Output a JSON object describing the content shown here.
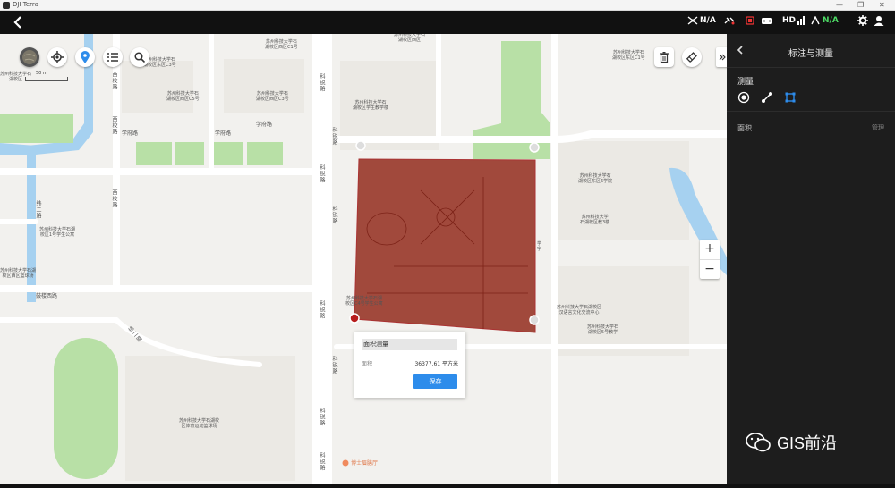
{
  "window": {
    "app_title": "DJI Terra",
    "controls": [
      "—",
      "❐",
      "✕"
    ]
  },
  "topbar": {
    "back_icon": "chevron-left-icon",
    "status": {
      "rc_signal": "N/A",
      "hd_label": "HD",
      "video_signal": "N/A",
      "video_signal_color": "#4cd964"
    }
  },
  "map": {
    "scale_label": "50 m",
    "pois": [
      "苏州科技大学石\n湖校区西区C1号",
      "苏州科技大学石\n湖校区西区",
      "苏州科技大学石\n湖校区东区C1号",
      "苏州科技大学石\n湖校区西区C5号",
      "苏州科技大学石\n湖校区西区C3号",
      "苏州科技大学石\n湖校区东区C3号",
      "苏州科技大学石\n湖校区",
      "苏州科技大学石\n湖校区学生教学楼",
      "苏州科技大学石\n湖校区东区6学院",
      "苏州科技大学\n石湖校区教3楼",
      "苏州科技大学石湖\n校区1号学生公寓",
      "苏州科技大学石湖校区\n汉语言文化交流中心",
      "苏州科技大学石\n湖校区5号教学",
      "苏州科技大学石湖校\n区体育运动篮球场",
      "苏州科技大学石湖\n校区西区篮球场",
      "苏州科技大学石湖\n校区C4号学生公寓",
      "学\n字"
    ],
    "roads": [
      "学府路",
      "学府路",
      "学府路",
      "科锐路",
      "科锐路",
      "科锐路",
      "科锐路",
      "科锐路",
      "科锐路",
      "科锐路",
      "科锐路",
      "西校路",
      "西校路",
      "西校路",
      "鼓楼西路",
      "纬二路",
      "纬二路"
    ],
    "restaurant": "博士眉膳厅",
    "zoom_in": "+",
    "zoom_out": "−",
    "polygon_color": "#8b1a0a"
  },
  "popup": {
    "name_value": "面积测量",
    "area_label": "面积",
    "area_value": "36377.61 平方米",
    "save_label": "保存"
  },
  "panel": {
    "title": "标注与测量",
    "section_label": "测量",
    "tools": [
      "point-tool-icon",
      "line-tool-icon",
      "polygon-tool-icon"
    ],
    "area_label": "面积",
    "area_action": "管理"
  },
  "watermark": "GIS前沿"
}
